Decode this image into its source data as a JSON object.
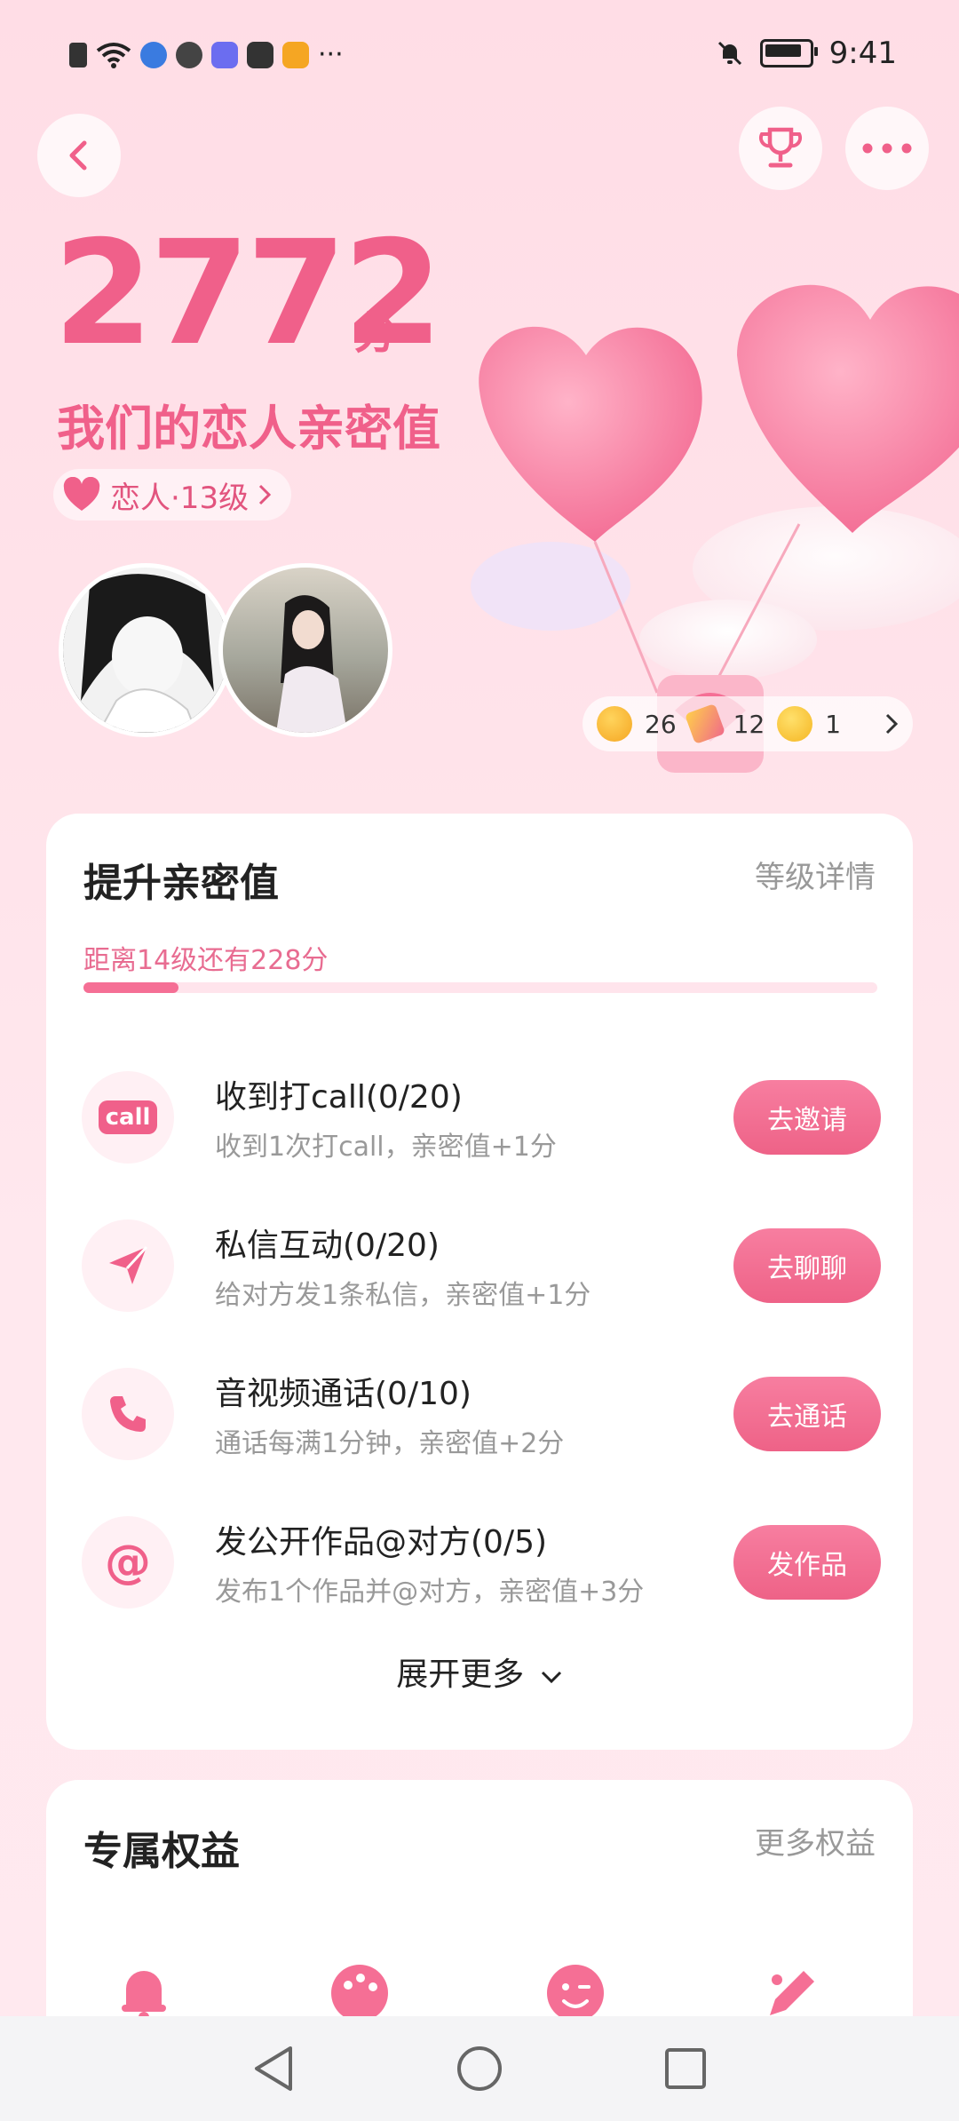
{
  "status_bar": {
    "time": "9:41",
    "more": "···"
  },
  "header": {
    "score": "2772",
    "score_unit": "分",
    "subtitle": "我们的恋人亲密值",
    "level_label": "恋人·13级"
  },
  "emoji_counts": [
    {
      "icon": "hug-face-icon",
      "count": "26"
    },
    {
      "icon": "party-popper-icon",
      "count": "12"
    },
    {
      "icon": "smirk-face-icon",
      "count": "1"
    }
  ],
  "boost_card": {
    "title": "提升亲密值",
    "link": "等级详情",
    "progress_text": "距离14级还有228分",
    "progress_fraction": 0.12,
    "tasks": [
      {
        "icon": "call",
        "title": "收到打call(0/20)",
        "desc": "收到1次打call，亲密值+1分",
        "button": "去邀请"
      },
      {
        "icon": "paper-plane-icon",
        "title": "私信互动(0/20)",
        "desc": "给对方发1条私信，亲密值+1分",
        "button": "去聊聊"
      },
      {
        "icon": "phone-icon",
        "title": "音视频通话(0/10)",
        "desc": "通话每满1分钟，亲密值+2分",
        "button": "去通话"
      },
      {
        "icon": "at-sign-icon",
        "title": "发公开作品@对方(0/5)",
        "desc": "发布1个作品并@对方，亲密值+3分",
        "button": "发作品"
      }
    ],
    "expand_label": "展开更多"
  },
  "perks_card": {
    "title": "专属权益",
    "link": "更多权益"
  },
  "colors": {
    "accent": "#f0608a",
    "button": "#ee6287",
    "bg": "#ffe3ea"
  }
}
